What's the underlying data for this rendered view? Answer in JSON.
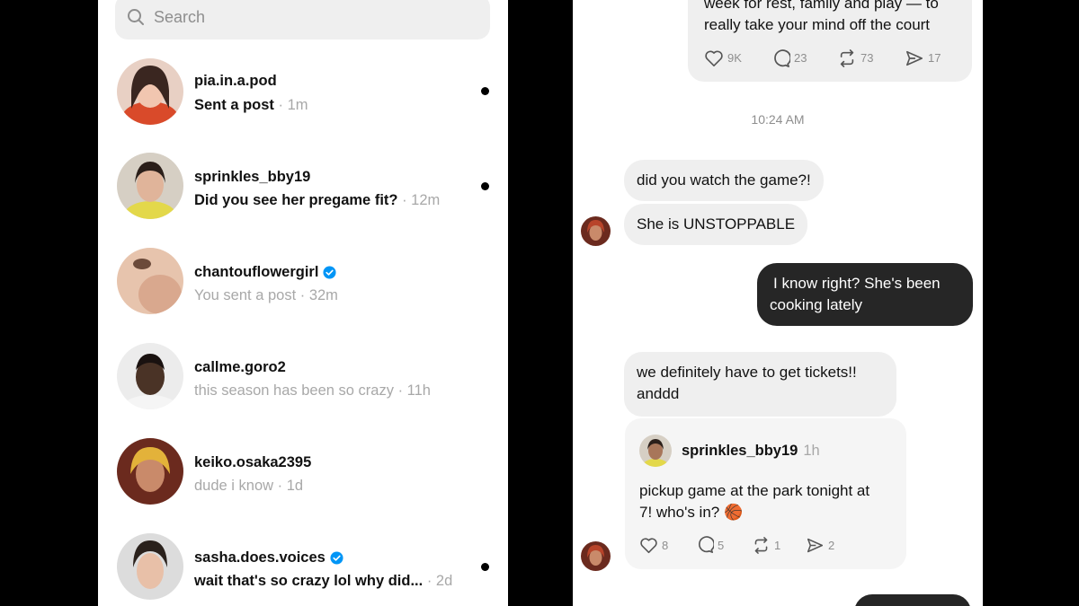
{
  "search": {
    "placeholder": "Search"
  },
  "conversations": [
    {
      "username": "pia.in.a.pod",
      "preview": "Sent a post",
      "time": "· 1m",
      "unread": true,
      "verified": false
    },
    {
      "username": "sprinkles_bby19",
      "preview": "Did you see her pregame fit?",
      "time": "· 12m",
      "unread": true,
      "verified": false
    },
    {
      "username": "chantouflowergirl",
      "preview": "You sent a post",
      "time": "· 32m",
      "unread": false,
      "verified": true
    },
    {
      "username": "callme.goro2",
      "preview": "this season has been so crazy",
      "time": "· 11h",
      "unread": false,
      "verified": false
    },
    {
      "username": "keiko.osaka2395",
      "preview": "dude i know",
      "time": "· 1d",
      "unread": false,
      "verified": false
    },
    {
      "username": "sasha.does.voices",
      "preview": "wait that's so crazy lol why did...",
      "time": "· 2d",
      "unread": true,
      "verified": true
    }
  ],
  "chat": {
    "top_post": {
      "text_line1": "week for rest, family and play — to",
      "text_line2": "really take your mind off the court",
      "likes": "9K",
      "replies": "23",
      "reposts": "73",
      "shares": "17"
    },
    "timestamp": "10:24 AM",
    "msg1": "did you watch the game?!",
    "msg2": "She is UNSTOPPABLE",
    "msg3_line1": "I know right? She's been",
    "msg3_line2": "cooking lately",
    "msg4_line1": "we definitely have to get tickets!!",
    "msg4_line2": "anddd",
    "shared_post": {
      "username": "sprinkles_bby19",
      "time": "1h",
      "text_line1": "pickup game at the park tonight at",
      "text_line2": "7! who's in? 🏀",
      "likes": "8",
      "replies": "5",
      "reposts": "1",
      "shares": "2"
    }
  },
  "colors": {
    "background": "#000000",
    "panel": "#ffffff",
    "incoming_bubble": "#efefef",
    "outgoing_bubble": "#262626",
    "verified": "#0095f6",
    "muted": "#8e8e8e"
  }
}
